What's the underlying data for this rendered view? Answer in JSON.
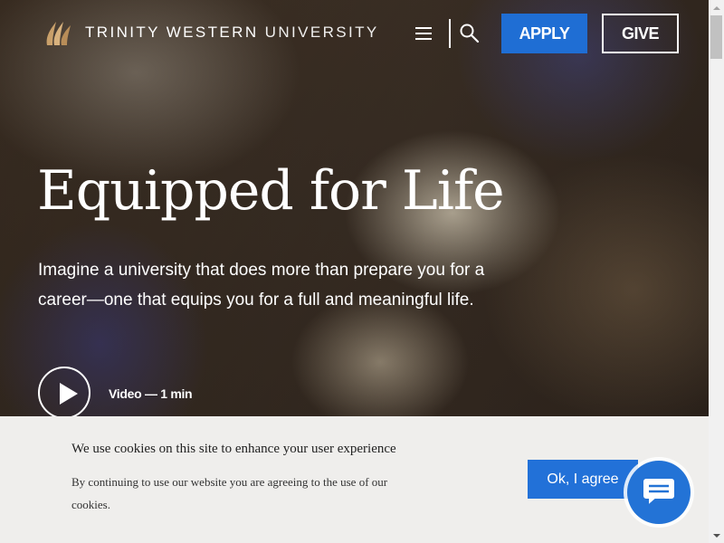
{
  "header": {
    "logo_icon": "flame-logo-icon",
    "logo_text_bold": "TRINITY WESTERN",
    "logo_text_thin": "UNIVERSITY",
    "menu_icon": "hamburger-menu-icon",
    "search_icon": "search-icon",
    "apply_label": "APPLY",
    "give_label": "GIVE"
  },
  "hero": {
    "title": "Equipped for Life",
    "subtitle": "Imagine a university that does more than prepare you for a career—one that equips you for a full and meaningful life.",
    "play_icon": "play-icon",
    "video_label": "Video — 1 min"
  },
  "cookie_banner": {
    "title": "We use cookies on this site to enhance your user experience",
    "body": "By continuing to use our website you are agreeing to the use of our cookies.",
    "ok_label": "Ok, I agree"
  },
  "chat": {
    "icon": "chat-bubble-icon"
  },
  "colors": {
    "apply_blue": "#1f6ed4",
    "ok_blue": "#2271d8",
    "logo_gold": "#c9a06a",
    "cookie_bg": "#efeeec"
  }
}
